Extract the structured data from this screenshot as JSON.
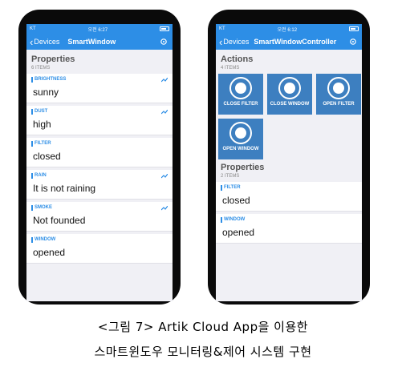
{
  "left_phone": {
    "status": {
      "carrier": "KT",
      "time": "오전 6:27"
    },
    "nav": {
      "back_label": "Devices",
      "title": "SmartWindow"
    },
    "section": {
      "title": "Properties",
      "subtitle": "6 ITEMS"
    },
    "properties": [
      {
        "label": "BRIGHTNESS",
        "value": "sunny",
        "trend": true
      },
      {
        "label": "DUST",
        "value": "high",
        "trend": true
      },
      {
        "label": "FILTER",
        "value": "closed",
        "trend": false
      },
      {
        "label": "RAIN",
        "value": "It is not raining",
        "trend": true
      },
      {
        "label": "SMOKE",
        "value": "Not founded",
        "trend": true
      },
      {
        "label": "WINDOW",
        "value": "opened",
        "trend": false
      }
    ]
  },
  "right_phone": {
    "status": {
      "carrier": "KT",
      "time": "오전 6:12"
    },
    "nav": {
      "back_label": "Devices",
      "title": "SmartWindowController"
    },
    "actions_section": {
      "title": "Actions",
      "subtitle": "4 ITEMS"
    },
    "actions": [
      {
        "label": "CLOSE FILTER"
      },
      {
        "label": "CLOSE WINDOW"
      },
      {
        "label": "OPEN FILTER"
      },
      {
        "label": "OPEN WINDOW"
      }
    ],
    "properties_section": {
      "title": "Properties",
      "subtitle": "2 ITEMS"
    },
    "properties": [
      {
        "label": "FILTER",
        "value": "closed"
      },
      {
        "label": "WINDOW",
        "value": "opened"
      }
    ]
  },
  "caption": {
    "line1": "<그림 7> Artik Cloud App을 이용한",
    "line2": "스마트윈도우 모니터링&제어 시스템 구현"
  },
  "colors": {
    "accent": "#2d8ee6",
    "tile": "#3d7fc0",
    "background": "#f0f0f5",
    "icons": [
      "gear-icon",
      "chevron-left-icon",
      "trend-icon",
      "action-circle-icon",
      "wifi-icon",
      "battery-icon"
    ]
  }
}
